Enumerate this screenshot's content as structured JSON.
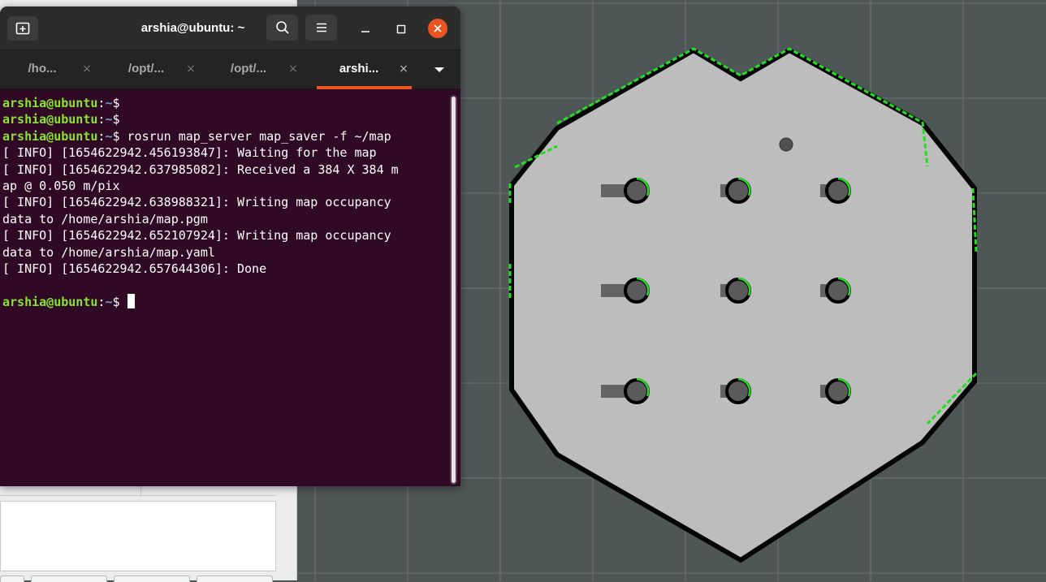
{
  "window": {
    "title": "arshia@ubuntu: ~",
    "icons": {
      "new_tab": "new-tab-icon",
      "search": "search-icon",
      "menu": "hamburger-menu-icon",
      "minimize": "minimize-icon",
      "maximize": "maximize-icon",
      "close": "close-icon"
    }
  },
  "tabs": [
    {
      "label": "/ho...",
      "close": "×",
      "active": false
    },
    {
      "label": "/opt/...",
      "close": "×",
      "active": false
    },
    {
      "label": "/opt/...",
      "close": "×",
      "active": false
    },
    {
      "label": "arshi...",
      "close": "×",
      "active": true
    }
  ],
  "terminal": {
    "prompt_user": "arshia@ubuntu",
    "prompt_sep": ":",
    "prompt_path": "~",
    "prompt_symbol": "$",
    "lines": [
      {
        "kind": "prompt",
        "command": ""
      },
      {
        "kind": "prompt",
        "command": ""
      },
      {
        "kind": "prompt",
        "command": " rosrun map_server map_saver -f ~/map"
      },
      {
        "kind": "output",
        "text": "[ INFO] [1654622942.456193847]: Waiting for the map"
      },
      {
        "kind": "output",
        "text": "[ INFO] [1654622942.637985082]: Received a 384 X 384 m"
      },
      {
        "kind": "output",
        "text": "ap @ 0.050 m/pix"
      },
      {
        "kind": "output",
        "text": "[ INFO] [1654622942.638988321]: Writing map occupancy"
      },
      {
        "kind": "output",
        "text": "data to /home/arshia/map.pgm"
      },
      {
        "kind": "output",
        "text": "[ INFO] [1654622942.652107924]: Writing map occupancy"
      },
      {
        "kind": "output",
        "text": "data to /home/arshia/map.yaml"
      },
      {
        "kind": "output",
        "text": "[ INFO] [1654622942.657644306]: Done"
      },
      {
        "kind": "output",
        "text": ""
      },
      {
        "kind": "prompt",
        "command": " ",
        "cursor": true
      }
    ]
  },
  "colors": {
    "terminal_bg": "#300a24",
    "prompt_user": "#8ae234",
    "prompt_path": "#729fcf",
    "accent": "#e95420",
    "viewport_bg": "#4f5656",
    "map_free": "#bdbdbd",
    "map_occupied": "#000000",
    "laser_scan": "#22dd22"
  },
  "map_view": {
    "grid": true,
    "obstacle_rows": 3,
    "obstacle_cols": 3
  }
}
